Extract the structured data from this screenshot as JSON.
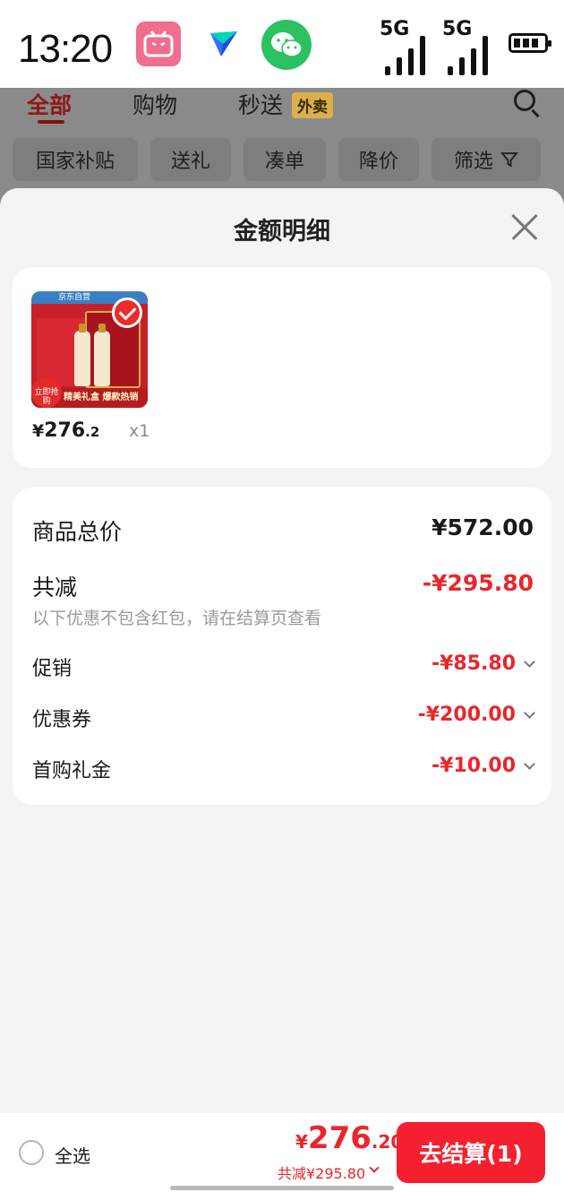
{
  "status_bar": {
    "time": "13:20",
    "apps": [
      "bilibili-icon",
      "feishu-icon",
      "wechat-icon"
    ],
    "signal1": "5G",
    "signal2": "5G"
  },
  "background_page": {
    "tabs": {
      "all": "全部",
      "shopping": "购物",
      "flash": "秒送",
      "takeout_badge": "外卖"
    },
    "filters": [
      "国家补贴",
      "送礼",
      "凑单",
      "降价",
      "筛选"
    ]
  },
  "sheet": {
    "title": "金额明细",
    "product": {
      "price_symbol": "¥",
      "price_int": "276",
      "price_dec": ".2",
      "quantity": "x1",
      "image_banner": "京东自营",
      "image_caption": "精美礼盒 爆款热销",
      "image_badge": "立即抢购"
    },
    "summary": {
      "total_label": "商品总价",
      "total_value": "¥572.00",
      "reduction_label": "共减",
      "reduction_value": "-¥295.80",
      "reduction_note": "以下优惠不包含红包，请在结算页查看",
      "items": [
        {
          "label": "促销",
          "value": "-¥85.80"
        },
        {
          "label": "优惠券",
          "value": "-¥200.00"
        },
        {
          "label": "首购礼金",
          "value": "-¥10.00"
        }
      ]
    }
  },
  "bottom_bar": {
    "select_all": "全选",
    "price_symbol": "¥",
    "price_int": "276",
    "price_dec": ".20",
    "reduction": "共减¥295.80",
    "checkout": "去结算(1)"
  },
  "colors": {
    "accent_red": "#e9262d",
    "checkout_red": "#f5202f"
  }
}
